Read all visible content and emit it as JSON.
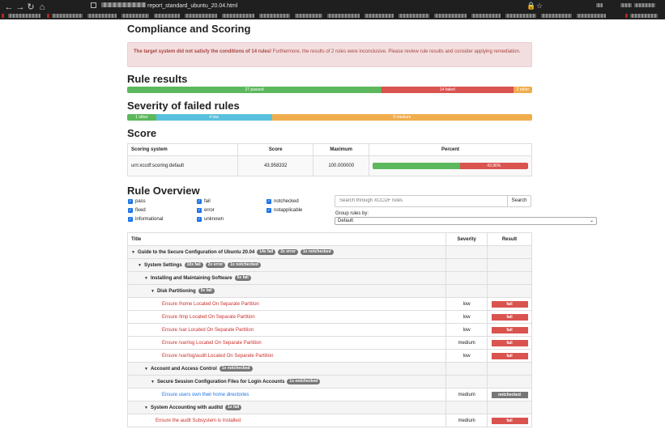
{
  "browser": {
    "url_text": "report_standard_ubuntu_20.04.html",
    "nav": [
      "←",
      "→",
      "↻",
      "⌂"
    ],
    "right_icons": [
      "🔒",
      "☆"
    ]
  },
  "compliance": {
    "title": "Compliance and Scoring",
    "alert_bold": "The target system did not satisfy the conditions of 14 rules!",
    "alert_rest": " Furthermore, the results of 2 rules were inconclusive. Please review rule results and consider applying remediation."
  },
  "rule_results": {
    "title": "Rule results",
    "passed": {
      "label": "27 passed",
      "count": 27
    },
    "failed": {
      "label": "14 failed",
      "count": 14
    },
    "other": {
      "label": "2 other",
      "count": 2
    }
  },
  "severity": {
    "title": "Severity of failed rules",
    "other": {
      "label": "1 other",
      "count": 1
    },
    "low": {
      "label": "4 low",
      "count": 4
    },
    "medium": {
      "label": "9 medium",
      "count": 9
    }
  },
  "score": {
    "title": "Score",
    "headers": {
      "system": "Scoring system",
      "score": "Score",
      "maximum": "Maximum",
      "percent": "Percent"
    },
    "row": {
      "system": "urn:xccdf:scoring:default",
      "score": "43.958332",
      "maximum": "100.000000",
      "percent_label": "43.96%",
      "percent": 43.96
    }
  },
  "overview": {
    "title": "Rule Overview",
    "checkboxes": [
      "pass",
      "fixed",
      "informational",
      "fail",
      "error",
      "unknown",
      "notchecked",
      "notapplicable"
    ],
    "search_placeholder": "Search through XCCDF rules",
    "search_button": "Search",
    "group_label": "Group rules by:",
    "group_value": "Default"
  },
  "rules_table": {
    "headers": {
      "title": "Title",
      "severity": "Severity",
      "result": "Result"
    },
    "rows": [
      {
        "type": "group",
        "title": "Guide to the Secure Configuration of Ubuntu 20.04",
        "badges": [
          "14x fail",
          "2x error",
          "1x notchecked"
        ]
      },
      {
        "type": "group",
        "title": "System Settings",
        "badges": [
          "10x fail",
          "2x error",
          "1x notchecked"
        ]
      },
      {
        "type": "group",
        "title": "Installing and Maintaining Software",
        "badges": [
          "5x fail"
        ]
      },
      {
        "type": "group",
        "title": "Disk Partitioning",
        "badges": [
          "5x fail"
        ]
      },
      {
        "type": "rule",
        "title": "Ensure /home Located On Separate Partition",
        "severity": "low",
        "result": "fail"
      },
      {
        "type": "rule",
        "title": "Ensure /tmp Located On Separate Partition",
        "severity": "low",
        "result": "fail"
      },
      {
        "type": "rule",
        "title": "Ensure /var Located On Separate Partition",
        "severity": "low",
        "result": "fail"
      },
      {
        "type": "rule",
        "title": "Ensure /var/log Located On Separate Partition",
        "severity": "medium",
        "result": "fail"
      },
      {
        "type": "rule",
        "title": "Ensure /var/log/audit Located On Separate Partition",
        "severity": "low",
        "result": "fail"
      },
      {
        "type": "group",
        "title": "Account and Access Control",
        "badges": [
          "1x notchecked"
        ]
      },
      {
        "type": "group",
        "title": "Secure Session Configuration Files for Login Accounts",
        "badges": [
          "1x notchecked"
        ]
      },
      {
        "type": "rule",
        "title": "Ensure users own their home directories",
        "severity": "medium",
        "result": "notchecked"
      },
      {
        "type": "group",
        "title": "System Accounting with auditd",
        "badges": [
          "1x fail"
        ]
      },
      {
        "type": "rule",
        "title": "Ensure the audit Subsystem is Installed",
        "severity": "medium",
        "result": "fail"
      }
    ]
  }
}
